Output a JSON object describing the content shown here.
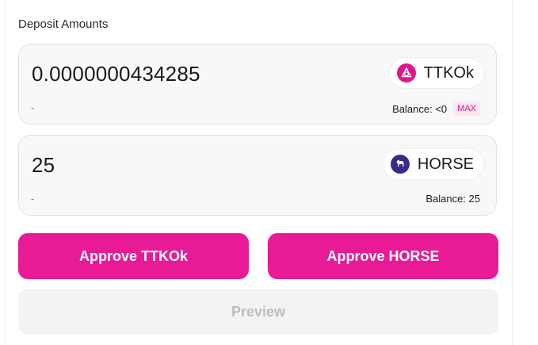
{
  "section_title": "Deposit Amounts",
  "inputs": [
    {
      "amount": "0.0000000434285",
      "usd_value": "-",
      "token": {
        "symbol": "TTKOk",
        "icon": "ttkok-token-icon",
        "color": "#e0168d"
      },
      "balance_label": "Balance: <0",
      "max_label": "MAX"
    },
    {
      "amount": "25",
      "usd_value": "-",
      "token": {
        "symbol": "HORSE",
        "icon": "horse-token-icon",
        "color": "#3d2a86"
      },
      "balance_label": "Balance: 25"
    }
  ],
  "buttons": {
    "approve_a": "Approve TTKOk",
    "approve_b": "Approve HORSE",
    "preview": "Preview"
  },
  "colors": {
    "accent": "#e91a95",
    "disabled_bg": "#f3f3f3",
    "disabled_text": "#bdbdbd"
  }
}
